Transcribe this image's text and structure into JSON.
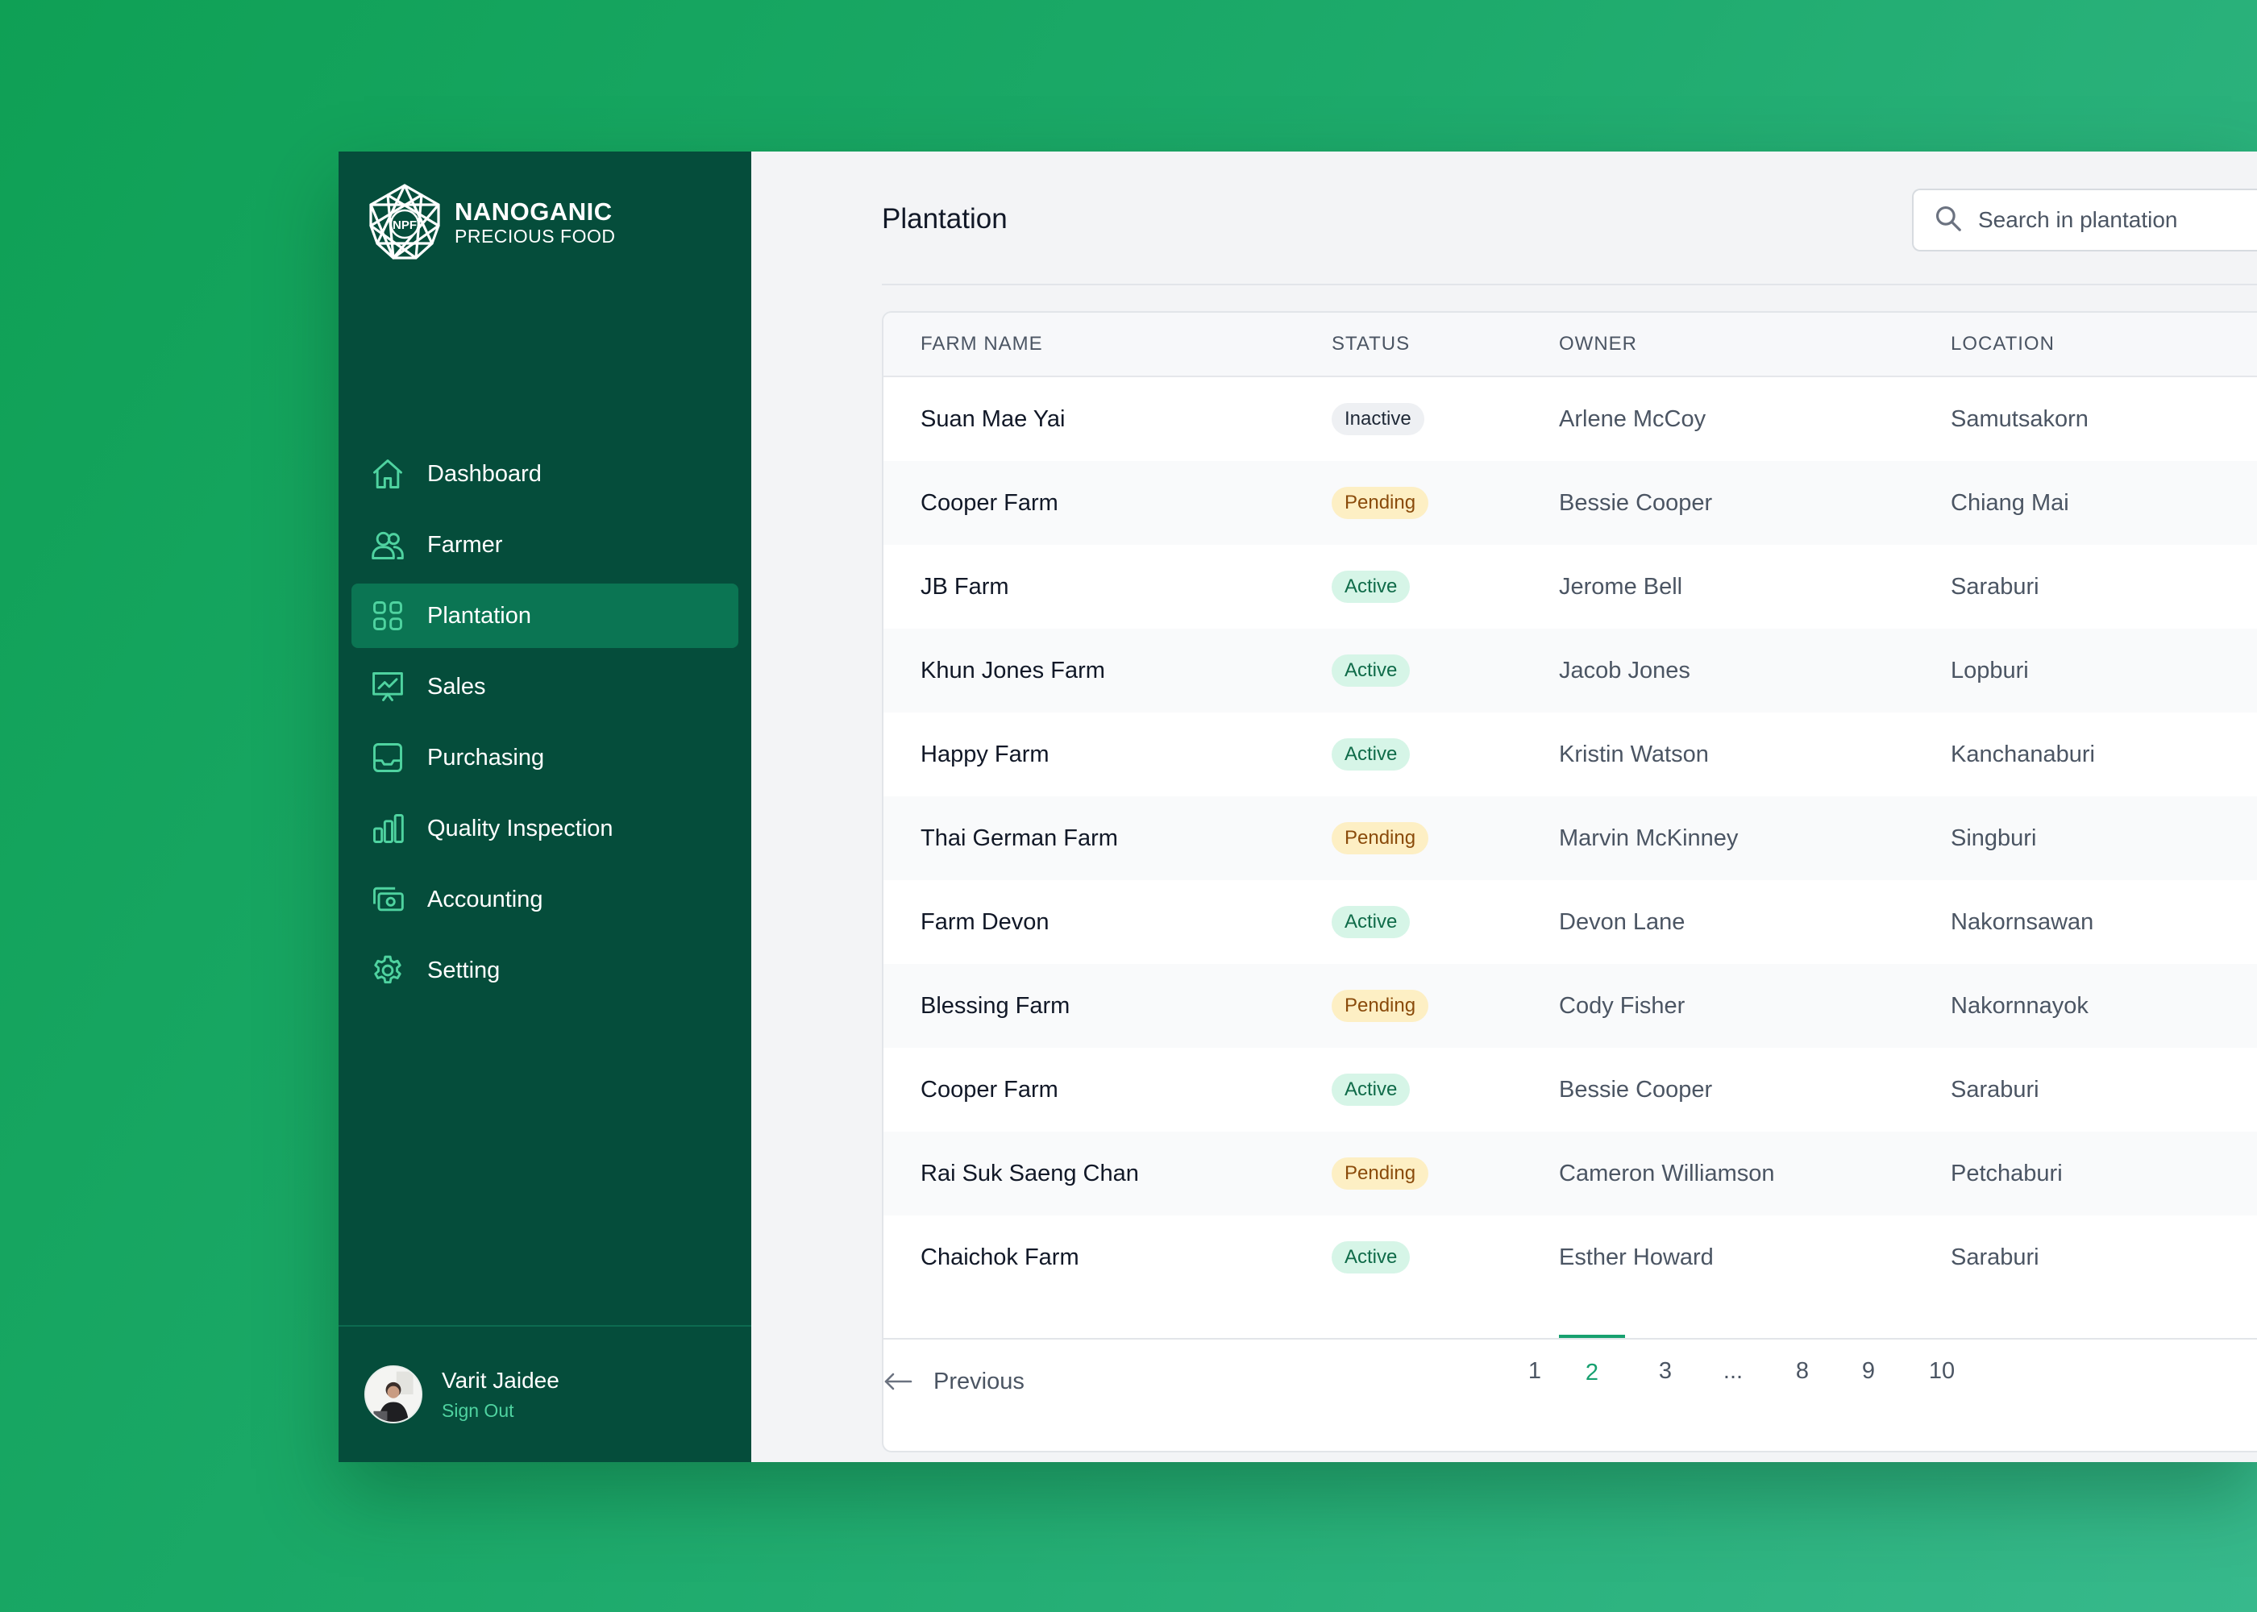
{
  "brand": {
    "line1": "NANOGANIC",
    "line2": "PRECIOUS FOOD",
    "mark": "NPF"
  },
  "sidebar": {
    "items": [
      {
        "label": "Dashboard",
        "icon": "home-icon"
      },
      {
        "label": "Farmer",
        "icon": "users-icon"
      },
      {
        "label": "Plantation",
        "icon": "grid-icon",
        "active": true
      },
      {
        "label": "Sales",
        "icon": "presentation-chart-icon"
      },
      {
        "label": "Purchasing",
        "icon": "inbox-icon"
      },
      {
        "label": "Quality Inspection",
        "icon": "bar-chart-icon"
      },
      {
        "label": "Accounting",
        "icon": "cash-icon"
      },
      {
        "label": "Setting",
        "icon": "gear-icon"
      }
    ],
    "user": {
      "name": "Varit Jaidee",
      "sign_out": "Sign Out"
    }
  },
  "main": {
    "title": "Plantation",
    "search": {
      "placeholder": "Search in plantation"
    },
    "table": {
      "columns": [
        "FARM NAME",
        "STATUS",
        "OWNER",
        "LOCATION"
      ],
      "rows": [
        {
          "farm": "Suan Mae Yai",
          "status": "Inactive",
          "owner": "Arlene McCoy",
          "location": "Samutsakorn"
        },
        {
          "farm": "Cooper Farm",
          "status": "Pending",
          "owner": "Bessie Cooper",
          "location": "Chiang Mai"
        },
        {
          "farm": "JB Farm",
          "status": "Active",
          "owner": "Jerome Bell",
          "location": "Saraburi"
        },
        {
          "farm": "Khun Jones Farm",
          "status": "Active",
          "owner": "Jacob Jones",
          "location": "Lopburi"
        },
        {
          "farm": "Happy Farm",
          "status": "Active",
          "owner": "Kristin Watson",
          "location": "Kanchanaburi"
        },
        {
          "farm": "Thai German Farm",
          "status": "Pending",
          "owner": "Marvin McKinney",
          "location": "Singburi"
        },
        {
          "farm": "Farm Devon",
          "status": "Active",
          "owner": "Devon Lane",
          "location": "Nakornsawan"
        },
        {
          "farm": "Blessing Farm",
          "status": "Pending",
          "owner": "Cody Fisher",
          "location": "Nakornnayok"
        },
        {
          "farm": "Cooper Farm",
          "status": "Active",
          "owner": "Bessie Cooper",
          "location": "Saraburi"
        },
        {
          "farm": "Rai Suk Saeng Chan",
          "status": "Pending",
          "owner": "Cameron Williamson",
          "location": "Petchaburi"
        },
        {
          "farm": "Chaichok Farm",
          "status": "Active",
          "owner": "Esther Howard",
          "location": "Saraburi"
        }
      ]
    },
    "pagination": {
      "previous": "Previous",
      "pages": [
        "1",
        "2",
        "3",
        "...",
        "8",
        "9",
        "10"
      ],
      "current": "2"
    }
  },
  "colors": {
    "sidebar_bg": "#054d3b",
    "active_nav": "#0b7553",
    "accent": "#17a06f",
    "background_gradient_start": "#0fa055",
    "background_gradient_end": "#37b98c"
  }
}
